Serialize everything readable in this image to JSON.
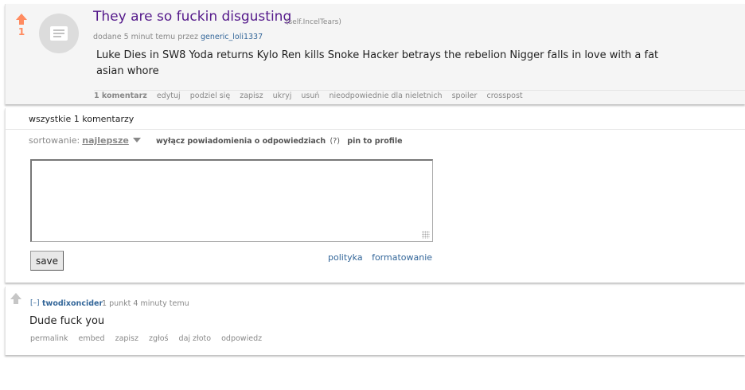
{
  "post": {
    "score": "1",
    "title": "They are so fuckin disgusting",
    "domain": "(self.IncelTears)",
    "tagline_prefix": "dodane 5 minut temu przez",
    "author": "generic_loli1337",
    "body": "Luke Dies in SW8 Yoda returns Kylo Ren kills Snoke Hacker betrays the rebelion Nigger falls in love with a fat asian whore",
    "buttons": [
      "1 komentarz",
      "edytuj",
      "podziel się",
      "zapisz",
      "ukryj",
      "usuń",
      "nieodpowiednie dla nieletnich",
      "spoiler",
      "crosspost"
    ]
  },
  "comments": {
    "header": "wszystkie 1 komentarzy",
    "sort_label": "sortowanie:",
    "sort_value": "najlepsze",
    "notify_label": "wyłącz powiadomienia o odpowiedziach",
    "notify_help": "(?)",
    "pin_label": "pin to profile",
    "save_label": "save",
    "policy_link": "polityka",
    "formatting_link": "formatowanie"
  },
  "reply": {
    "collapse": "[–]",
    "author": "twodixoncider",
    "meta": "1 punkt 4 minuty temu",
    "text": "Dude fuck you",
    "buttons": [
      "permalink",
      "embed",
      "zapisz",
      "zgłoś",
      "daj złoto",
      "odpowiedz"
    ]
  },
  "colors": {
    "upvote": "#ff8b60",
    "link": "#336699",
    "title_visited": "#551a8b",
    "muted": "#888888"
  },
  "icons": [
    "upvote-arrow-icon",
    "text-post-thumbnail-icon",
    "sort-caret-icon",
    "resize-grip-icon"
  ]
}
